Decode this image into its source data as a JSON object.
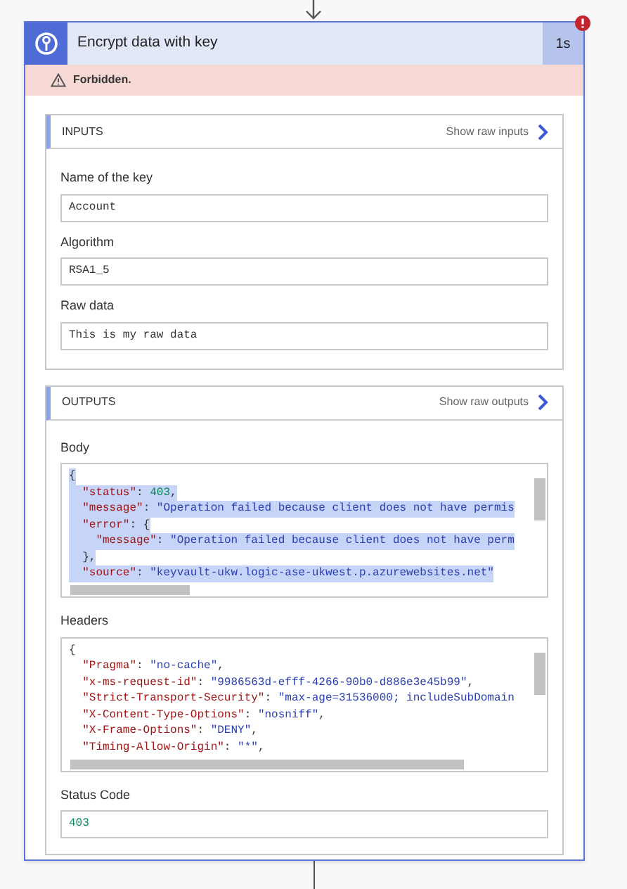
{
  "step": {
    "title": "Encrypt data with key",
    "duration": "1s",
    "failed": true,
    "error": "Forbidden."
  },
  "inputs": {
    "title": "INPUTS",
    "raw_link": "Show raw inputs",
    "fields": [
      {
        "label": "Name of the key",
        "value": "Account"
      },
      {
        "label": "Algorithm",
        "value": "RSA1_5"
      },
      {
        "label": "Raw data",
        "value": "This is my raw data"
      }
    ]
  },
  "outputs": {
    "title": "OUTPUTS",
    "raw_link": "Show raw outputs",
    "blocks": [
      {
        "label": "Body",
        "selected": true,
        "lines": [
          [
            {
              "kind": "punct",
              "text": "{"
            }
          ],
          [
            {
              "kind": "key",
              "text": "  \"status\""
            },
            {
              "kind": "punct",
              "text": ": "
            },
            {
              "kind": "number",
              "text": "403"
            },
            {
              "kind": "punct",
              "text": ","
            }
          ],
          [
            {
              "kind": "key",
              "text": "  \"message\""
            },
            {
              "kind": "punct",
              "text": ": "
            },
            {
              "kind": "string",
              "text": "\"Operation failed because client does not have permis"
            }
          ],
          [
            {
              "kind": "key",
              "text": "  \"error\""
            },
            {
              "kind": "punct",
              "text": ": {"
            }
          ],
          [
            {
              "kind": "key",
              "text": "    \"message\""
            },
            {
              "kind": "punct",
              "text": ": "
            },
            {
              "kind": "string",
              "text": "\"Operation failed because client does not have perm"
            }
          ],
          [
            {
              "kind": "punct",
              "text": "  },"
            }
          ],
          [
            {
              "kind": "key",
              "text": "  \"source\""
            },
            {
              "kind": "punct",
              "text": ": "
            },
            {
              "kind": "string",
              "text": "\"keyvault-ukw.logic-ase-ukwest.p.azurewebsites.net\""
            }
          ]
        ]
      },
      {
        "label": "Headers",
        "selected": false,
        "lines": [
          [
            {
              "kind": "punct",
              "text": "{"
            }
          ],
          [
            {
              "kind": "key",
              "text": "  \"Pragma\""
            },
            {
              "kind": "punct",
              "text": ": "
            },
            {
              "kind": "string",
              "text": "\"no-cache\""
            },
            {
              "kind": "punct",
              "text": ","
            }
          ],
          [
            {
              "kind": "key",
              "text": "  \"x-ms-request-id\""
            },
            {
              "kind": "punct",
              "text": ": "
            },
            {
              "kind": "string",
              "text": "\"9986563d-efff-4266-90b0-d886e3e45b99\""
            },
            {
              "kind": "punct",
              "text": ","
            }
          ],
          [
            {
              "kind": "key",
              "text": "  \"Strict-Transport-Security\""
            },
            {
              "kind": "punct",
              "text": ": "
            },
            {
              "kind": "string",
              "text": "\"max-age=31536000; includeSubDomain"
            }
          ],
          [
            {
              "kind": "key",
              "text": "  \"X-Content-Type-Options\""
            },
            {
              "kind": "punct",
              "text": ": "
            },
            {
              "kind": "string",
              "text": "\"nosniff\""
            },
            {
              "kind": "punct",
              "text": ","
            }
          ],
          [
            {
              "kind": "key",
              "text": "  \"X-Frame-Options\""
            },
            {
              "kind": "punct",
              "text": ": "
            },
            {
              "kind": "string",
              "text": "\"DENY\""
            },
            {
              "kind": "punct",
              "text": ","
            }
          ],
          [
            {
              "kind": "key",
              "text": "  \"Timing-Allow-Origin\""
            },
            {
              "kind": "punct",
              "text": ": "
            },
            {
              "kind": "string",
              "text": "\"*\""
            },
            {
              "kind": "punct",
              "text": ","
            }
          ]
        ]
      }
    ],
    "status": {
      "label": "Status Code",
      "value": "403"
    }
  }
}
